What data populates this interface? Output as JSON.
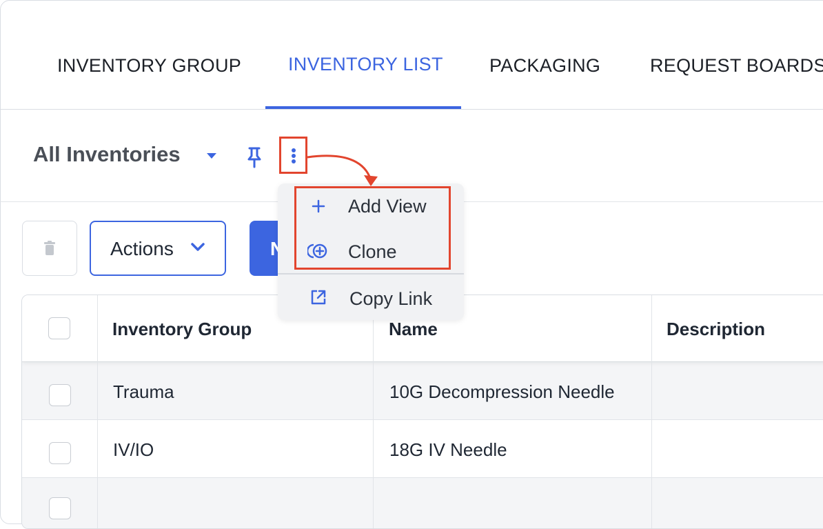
{
  "tabs": [
    {
      "label": "INVENTORY GROUP",
      "active": false
    },
    {
      "label": "INVENTORY LIST",
      "active": true
    },
    {
      "label": "PACKAGING",
      "active": false
    },
    {
      "label": "REQUEST BOARDS",
      "active": false
    }
  ],
  "view": {
    "title": "All Inventories",
    "icons": [
      "caret-down-icon",
      "pin-icon",
      "kebab-icon"
    ]
  },
  "toolbar": {
    "actions_label": "Actions",
    "new_label": "N"
  },
  "menu": {
    "items": [
      {
        "label": "Add View",
        "icon": "plus-icon"
      },
      {
        "label": "Clone",
        "icon": "clone-icon"
      },
      {
        "label": "Copy Link",
        "icon": "external-link-icon"
      }
    ]
  },
  "table": {
    "columns": [
      "Inventory Group",
      "Name",
      "Description"
    ],
    "rows": [
      {
        "group": "Trauma",
        "name": "10G Decompression Needle",
        "description": ""
      },
      {
        "group": "IV/IO",
        "name": "18G IV Needle",
        "description": ""
      },
      {
        "group": "",
        "name": "",
        "description": ""
      }
    ]
  },
  "colors": {
    "accent": "#3c65e0",
    "highlight": "#e2452e",
    "text": "#1f2733"
  }
}
